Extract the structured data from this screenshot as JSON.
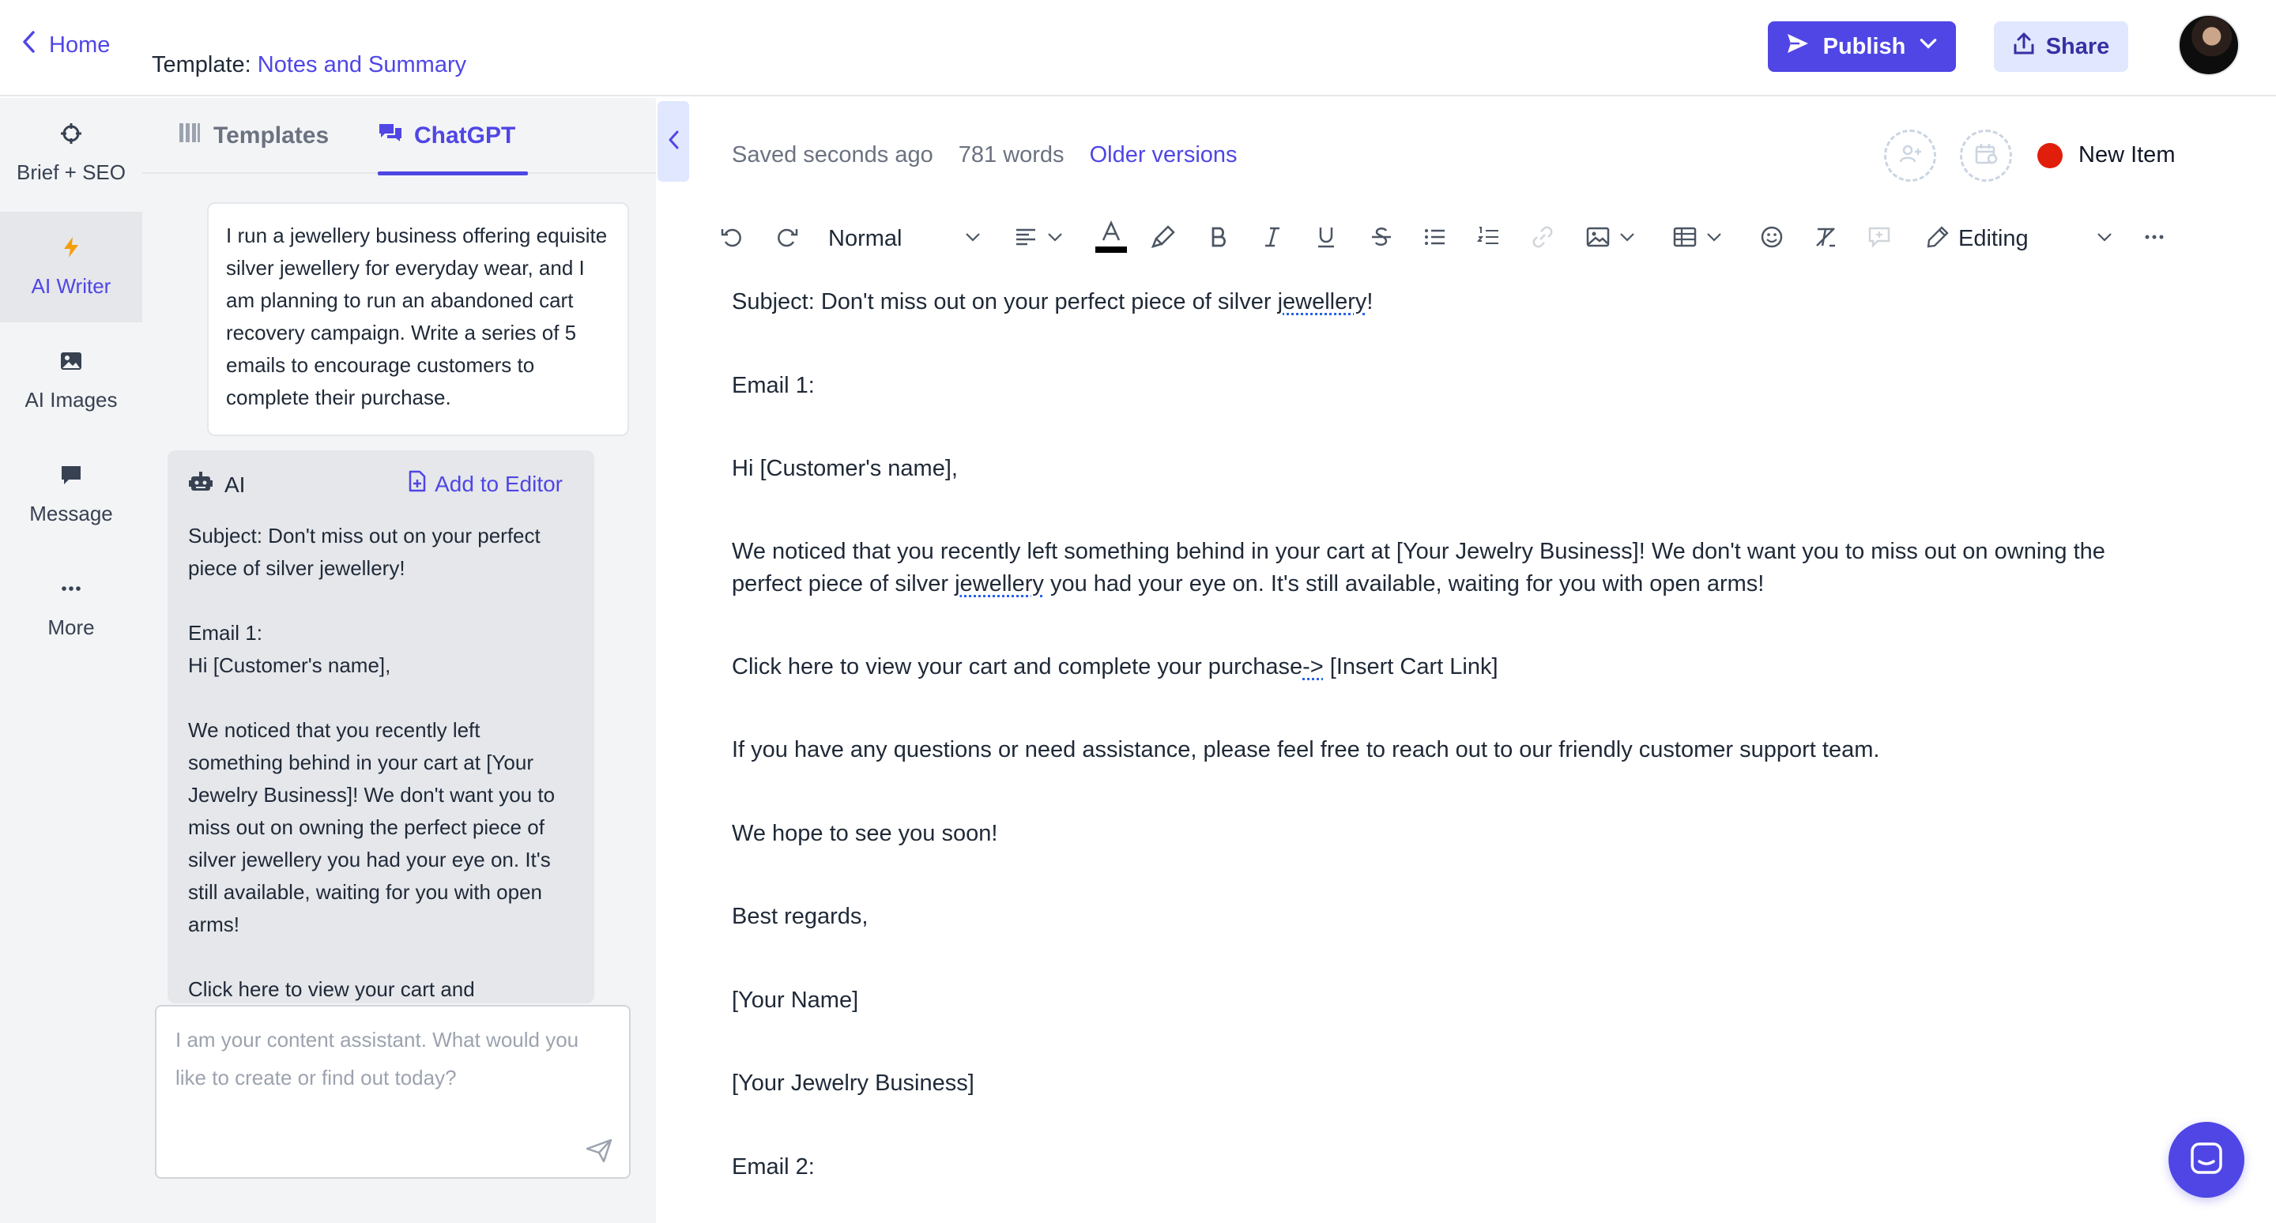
{
  "header": {
    "home_label": "Home",
    "template_prefix": "Template:",
    "template_name": "Notes and Summary",
    "publish_label": "Publish",
    "share_label": "Share"
  },
  "rail": {
    "items": [
      {
        "label": "Brief + SEO",
        "icon": "crosshair-icon"
      },
      {
        "label": "AI Writer",
        "icon": "lightning-icon",
        "active": true
      },
      {
        "label": "AI Images",
        "icon": "image-icon"
      },
      {
        "label": "Message",
        "icon": "message-icon"
      },
      {
        "label": "More",
        "icon": "more-icon"
      }
    ]
  },
  "panel": {
    "tabs": [
      {
        "label": "Templates",
        "icon": "templates-icon"
      },
      {
        "label": "ChatGPT",
        "icon": "chat-icon",
        "active": true
      }
    ],
    "prompt": "I run a jewellery business offering equisite silver jewellery for everyday wear, and I am planning to run an abandoned cart recovery campaign. Write a series of 5 emails to encourage customers to complete their purchase.",
    "ai_label": "AI",
    "add_to_editor_label": "Add to Editor",
    "ai_response": "Subject: Don't miss out on your perfect piece of silver jewellery!\n\nEmail 1:\nHi [Customer's name],\n\nWe noticed that you recently left something behind in your cart at [Your Jewelry Business]! We don't want you to miss out on owning the perfect piece of silver jewellery you had your eye on. It's still available, waiting for you with open arms!\n\nClick here to view your cart and",
    "input_placeholder": "I am your content assistant. What would you like to create or find out today?"
  },
  "editor": {
    "saved_status": "Saved seconds ago",
    "word_count": "781 words",
    "older_versions_label": "Older versions",
    "new_item_label": "New Item",
    "style_select": "Normal",
    "mode_select": "Editing",
    "text_color": "#000000",
    "paragraphs": [
      {
        "pre": "Subject: Don't miss out on your perfect piece of silver ",
        "spell": "jewellery",
        "post": "!"
      },
      {
        "pre": "Email 1:",
        "spell": "",
        "post": ""
      },
      {
        "pre": "Hi [Customer's name],",
        "spell": "",
        "post": ""
      },
      {
        "pre": "We noticed that you recently left something behind in your cart at [Your Jewelry Business]! We don't want you to miss out on owning the perfect piece of silver ",
        "spell": "jewellery",
        "post": " you had your eye on. It's still available, waiting for you with open arms!"
      },
      {
        "pre": "Click here to view your cart and complete your purchase",
        "spell": "->",
        "post": " [Insert Cart Link]"
      },
      {
        "pre": "If you have any questions or need assistance, please feel free to reach out to our friendly customer support team.",
        "spell": "",
        "post": ""
      },
      {
        "pre": "We hope to see you soon!",
        "spell": "",
        "post": ""
      },
      {
        "pre": "Best regards,",
        "spell": "",
        "post": ""
      },
      {
        "pre": "[Your Name]",
        "spell": "",
        "post": ""
      },
      {
        "pre": "[Your Jewelry Business]",
        "spell": "",
        "post": ""
      },
      {
        "pre": "Email 2:",
        "spell": "",
        "post": ""
      }
    ]
  },
  "colors": {
    "accent": "#4f46e5",
    "accent_light": "#e0e7ff",
    "status_red": "#e11d0b",
    "rail_bg": "#f3f4f6"
  }
}
